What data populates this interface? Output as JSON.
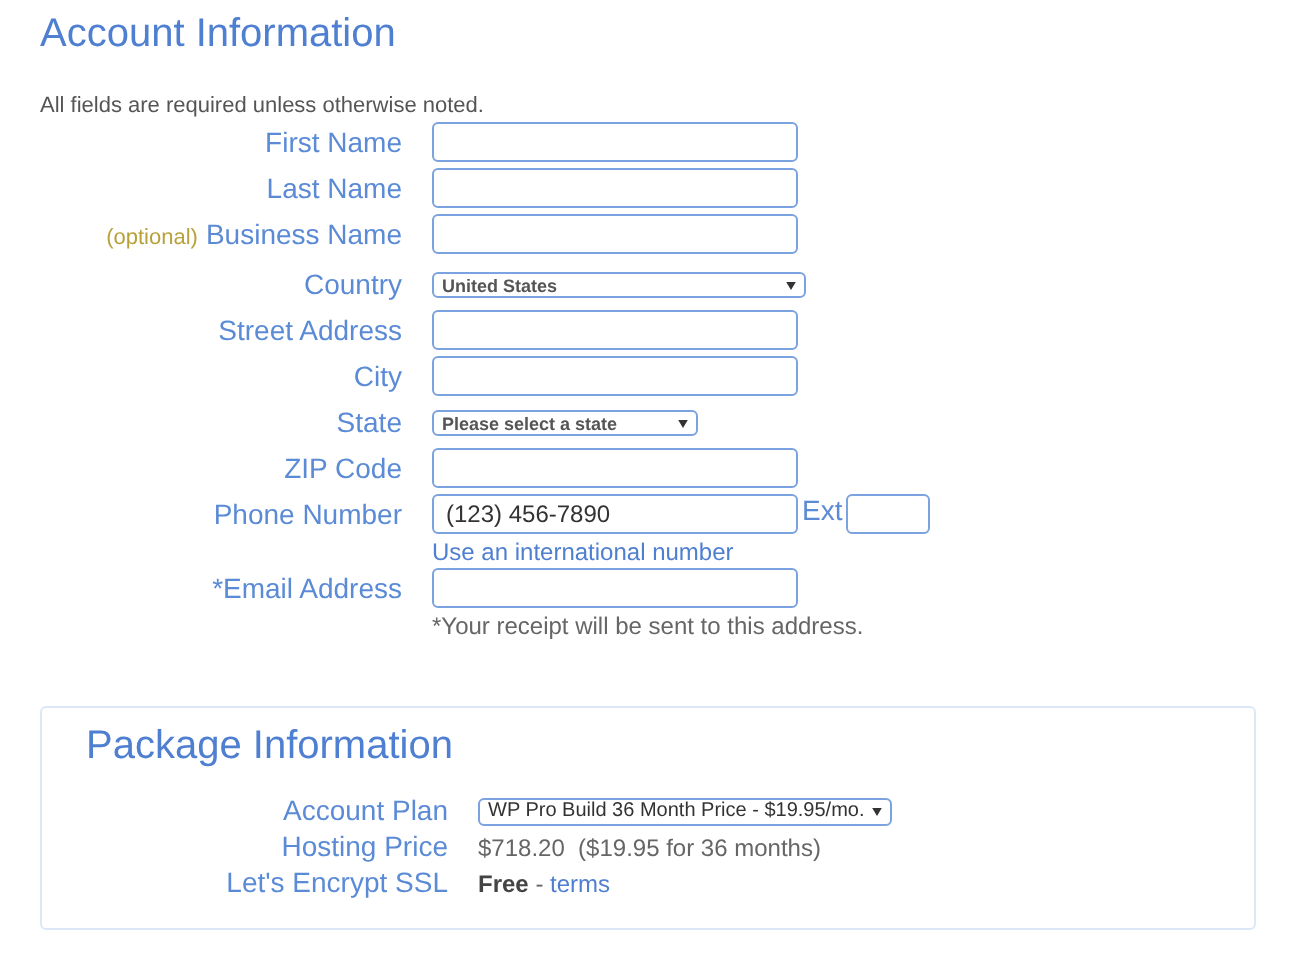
{
  "account": {
    "title": "Account Information",
    "intro": "All fields are required unless otherwise noted.",
    "fields": [
      {
        "kind": "text",
        "label": "First Name"
      },
      {
        "kind": "text",
        "label": "Last Name"
      },
      {
        "kind": "text",
        "label": "Business Name",
        "note": "(optional)"
      },
      {
        "kind": "select",
        "label": "Country",
        "value": "United States"
      },
      {
        "kind": "text",
        "label": "Street Address"
      },
      {
        "kind": "text",
        "label": "City"
      },
      {
        "kind": "select-short",
        "label": "State",
        "value": "Please select a state"
      },
      {
        "kind": "text",
        "label": "ZIP Code"
      },
      {
        "kind": "text",
        "label": "Phone Number",
        "value": "(123) 456-7890",
        "ext": "Ext",
        "link": "Use an international number"
      },
      {
        "kind": "text",
        "label": "*Email Address",
        "hint": "*Your receipt will be sent to this address."
      }
    ]
  },
  "package": {
    "title": "Package Information",
    "rows": [
      {
        "kind": "select",
        "label": "Account Plan",
        "value": "WP Pro Build 36 Month Price - $19.95/mo."
      },
      {
        "kind": "text",
        "label": "Hosting Price",
        "value": "$718.20  ($19.95 for 36 months)"
      },
      {
        "kind": "free",
        "label": "Let's Encrypt SSL",
        "value": "Free",
        "sep": " - ",
        "link": "terms"
      }
    ]
  }
}
